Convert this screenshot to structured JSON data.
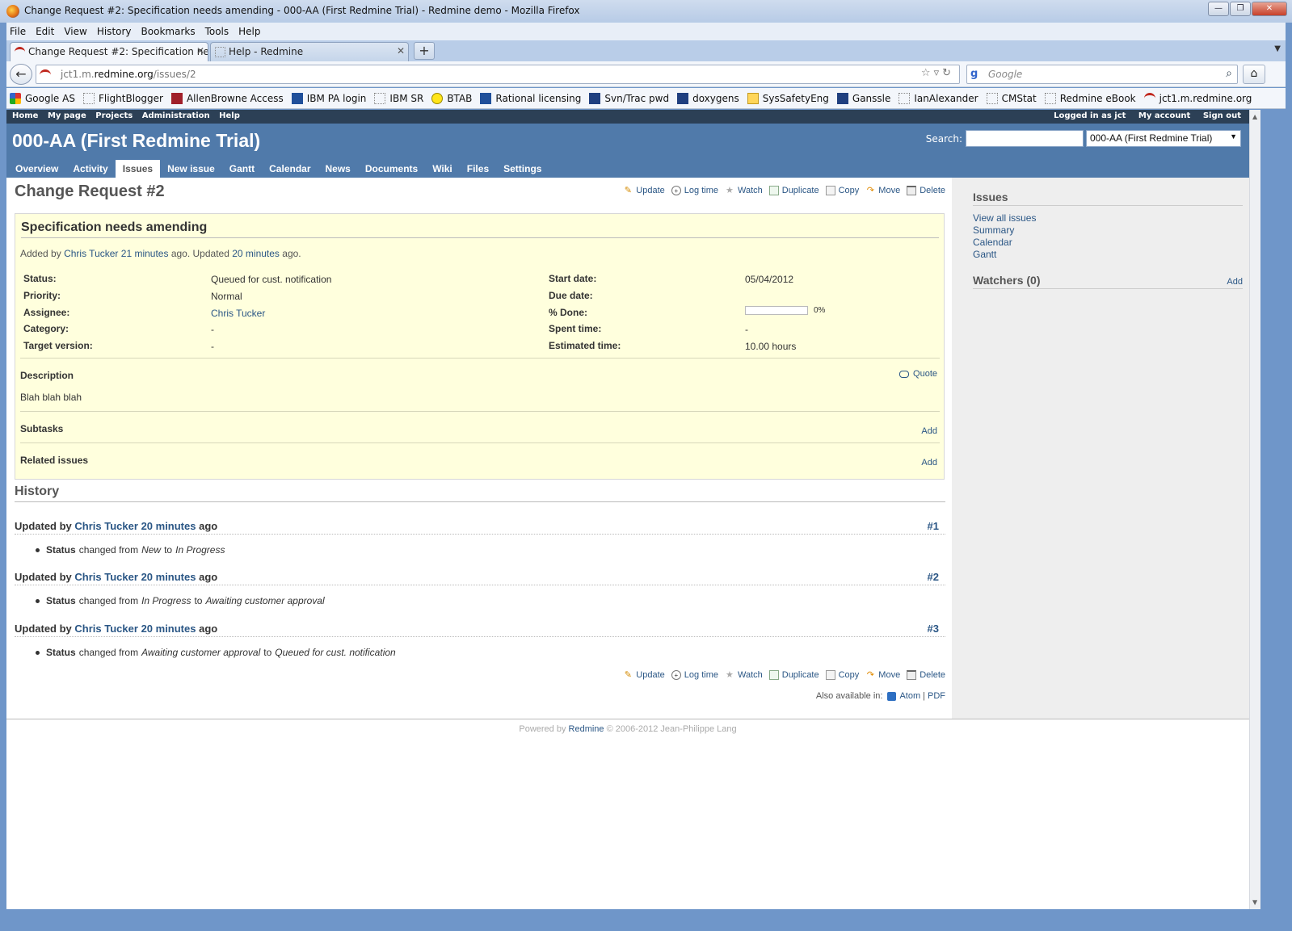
{
  "window": {
    "title": "Change Request #2: Specification needs amending - 000-AA (First Redmine Trial) - Redmine demo - Mozilla Firefox",
    "controls": [
      "—",
      "❐",
      "✕"
    ]
  },
  "menubar": [
    "File",
    "Edit",
    "View",
    "History",
    "Bookmarks",
    "Tools",
    "Help"
  ],
  "tabs": [
    {
      "label": "Change Request #2: Specification nee...",
      "active": true
    },
    {
      "label": "Help - Redmine",
      "active": false
    }
  ],
  "navbar": {
    "url_prefix": "jct1.m.",
    "url_domain": "redmine.org",
    "url_path": "/issues/2",
    "search_placeholder": "Google"
  },
  "bookmarks": [
    {
      "label": "Google AS",
      "icon": "google-icon"
    },
    {
      "label": "FlightBlogger",
      "icon": "page-icon"
    },
    {
      "label": "AllenBrowne Access",
      "icon": "access-icon"
    },
    {
      "label": "IBM PA login",
      "icon": "ibm-icon"
    },
    {
      "label": "IBM SR",
      "icon": "page-icon"
    },
    {
      "label": "BTAB",
      "icon": "yellow-circle-icon"
    },
    {
      "label": "Rational licensing",
      "icon": "ibm-icon"
    },
    {
      "label": "Svn/Trac pwd",
      "icon": "ibm-icon"
    },
    {
      "label": "doxygens",
      "icon": "ibm-icon"
    },
    {
      "label": "SysSafetyEng",
      "icon": "folder-icon"
    },
    {
      "label": "Ganssle",
      "icon": "ganssle-icon"
    },
    {
      "label": "IanAlexander",
      "icon": "page-icon"
    },
    {
      "label": "CMStat",
      "icon": "page-icon"
    },
    {
      "label": "Redmine eBook",
      "icon": "page-icon"
    },
    {
      "label": "jct1.m.redmine.org",
      "icon": "redmine-icon"
    }
  ],
  "top_menu": {
    "left": [
      "Home",
      "My page",
      "Projects",
      "Administration",
      "Help"
    ],
    "logged_in": "Logged in as jct",
    "right": [
      "My account",
      "Sign out"
    ]
  },
  "header": {
    "project_title": "000-AA (First Redmine Trial)",
    "search_label": "Search:",
    "project_jump": "000-AA (First Redmine Trial)"
  },
  "main_menu": [
    "Overview",
    "Activity",
    "Issues",
    "New issue",
    "Gantt",
    "Calendar",
    "News",
    "Documents",
    "Wiki",
    "Files",
    "Settings"
  ],
  "main_menu_selected": "Issues",
  "actions": {
    "update": "Update",
    "log_time": "Log time",
    "watch": "Watch",
    "duplicate": "Duplicate",
    "copy": "Copy",
    "move": "Move",
    "delete": "Delete"
  },
  "issue": {
    "heading": "Change Request #2",
    "subject": "Specification needs amending",
    "author_prefix": "Added by",
    "author": "Chris Tucker",
    "added_ago": "21 minutes",
    "added_mid": "ago. Updated",
    "updated_ago": "20 minutes",
    "updated_suffix": "ago.",
    "attributes_left": [
      {
        "label": "Status:",
        "value": "Queued for cust. notification"
      },
      {
        "label": "Priority:",
        "value": "Normal"
      },
      {
        "label": "Assignee:",
        "value": "Chris Tucker"
      },
      {
        "label": "Category:",
        "value": "-"
      },
      {
        "label": "Target version:",
        "value": "-"
      }
    ],
    "attributes_right": [
      {
        "label": "Start date:",
        "value": "05/04/2012"
      },
      {
        "label": "Due date:",
        "value": ""
      },
      {
        "label": "% Done:",
        "value": "0%"
      },
      {
        "label": "Spent time:",
        "value": "-"
      },
      {
        "label": "Estimated time:",
        "value": "10.00 hours"
      }
    ],
    "done_ratio": 0,
    "description_label": "Description",
    "quote": "Quote",
    "description": "Blah blah blah",
    "subtasks_label": "Subtasks",
    "related_label": "Related issues",
    "add": "Add"
  },
  "history": {
    "title": "History",
    "journals": [
      {
        "prefix": "Updated by",
        "user": "Chris Tucker",
        "ago": "20 minutes",
        "suffix": "ago",
        "num": "#1",
        "field": "Status",
        "changed": "changed from",
        "from": "New",
        "to_word": "to",
        "to": "In Progress"
      },
      {
        "prefix": "Updated by",
        "user": "Chris Tucker",
        "ago": "20 minutes",
        "suffix": "ago",
        "num": "#2",
        "field": "Status",
        "changed": "changed from",
        "from": "In Progress",
        "to_word": "to",
        "to": "Awaiting customer approval"
      },
      {
        "prefix": "Updated by",
        "user": "Chris Tucker",
        "ago": "20 minutes",
        "suffix": "ago",
        "num": "#3",
        "field": "Status",
        "changed": "changed from",
        "from": "Awaiting customer approval",
        "to_word": "to",
        "to": "Queued for cust. notification"
      }
    ]
  },
  "other_formats": {
    "label": "Also available in:",
    "atom": "Atom",
    "sep": "|",
    "pdf": "PDF"
  },
  "sidebar": {
    "issues_title": "Issues",
    "links": [
      "View all issues",
      "Summary",
      "Calendar",
      "Gantt"
    ],
    "watchers_title": "Watchers (0)",
    "watchers_add": "Add"
  },
  "footer": {
    "prefix": "Powered by",
    "link": "Redmine",
    "suffix": "© 2006-2012 Jean-Philippe Lang"
  }
}
